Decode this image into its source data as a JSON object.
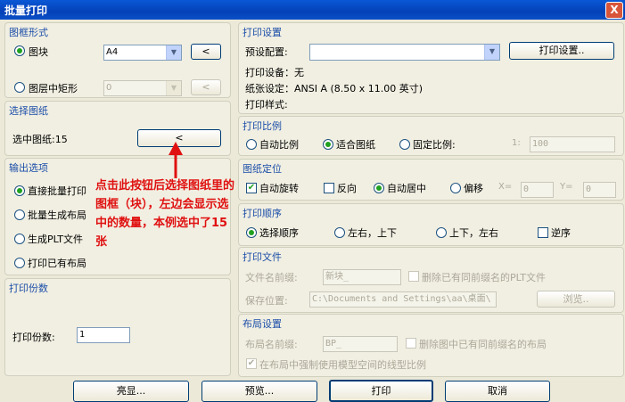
{
  "window": {
    "title": "批量打印",
    "close_symbol": "X"
  },
  "frame_form": {
    "title": "图框形式",
    "block_label": "图块",
    "block_value": "A4",
    "rect_label": "图层中矩形",
    "rect_value": "0",
    "pick_symbol": "<"
  },
  "select_sheets": {
    "title": "选择图纸",
    "count_label": "选中图纸:15",
    "pick_symbol": "<"
  },
  "output": {
    "title": "输出选项",
    "options": [
      "直接批量打印",
      "批量生成布局",
      "生成PLT文件",
      "打印已有布局"
    ]
  },
  "copies": {
    "title": "打印份数",
    "label": "打印份数:",
    "value": "1"
  },
  "print_settings": {
    "title": "打印设置",
    "preset_label": "预设配置:",
    "preset_value": "",
    "setup_button": "打印设置..",
    "device": "打印设备：无",
    "paper": "纸张设定：ANSI A (8.50 x 11.00 英寸)",
    "style": "打印样式:"
  },
  "scale": {
    "title": "打印比例",
    "auto": "自动比例",
    "fit": "适合图纸",
    "fixed": "固定比例:",
    "ratio_prefix": "1:",
    "ratio_value": "100"
  },
  "position": {
    "title": "图纸定位",
    "auto_rotate": "自动旋转",
    "reverse": "反向",
    "auto_center": "自动居中",
    "offset": "偏移",
    "x_label": "X=",
    "x_value": "0",
    "y_label": "Y=",
    "y_value": "0"
  },
  "order": {
    "title": "打印顺序",
    "options": [
      "选择顺序",
      "左右，上下",
      "上下，左右"
    ],
    "reverse": "逆序"
  },
  "print_file": {
    "title": "打印文件",
    "prefix_label": "文件名前缀:",
    "prefix_value": "新块_",
    "delete_old": "删除已有同前缀名的PLT文件",
    "save_label": "保存位置:",
    "save_value": "C:\\Documents and Settings\\aa\\桌面\\",
    "browse": "浏览.."
  },
  "layout_settings": {
    "title": "布局设置",
    "prefix_label": "布局名前缀:",
    "prefix_value": "BP_",
    "delete_old": "删除图中已有同前缀名的布局",
    "use_model_linetype": "在布局中强制使用模型空间的线型比例"
  },
  "buttons": {
    "highlight": "亮显...",
    "preview": "预览...",
    "print": "打印",
    "cancel": "取消"
  },
  "annotation": "点击此按钮后选择图纸里的图框（块），左边会显示选中的数量，本例选中了15张",
  "colors": {
    "title_bar": "#0441b8",
    "group_title": "#1c4ea8",
    "annotation": "#e01010",
    "radio_dot": "#21a121"
  }
}
